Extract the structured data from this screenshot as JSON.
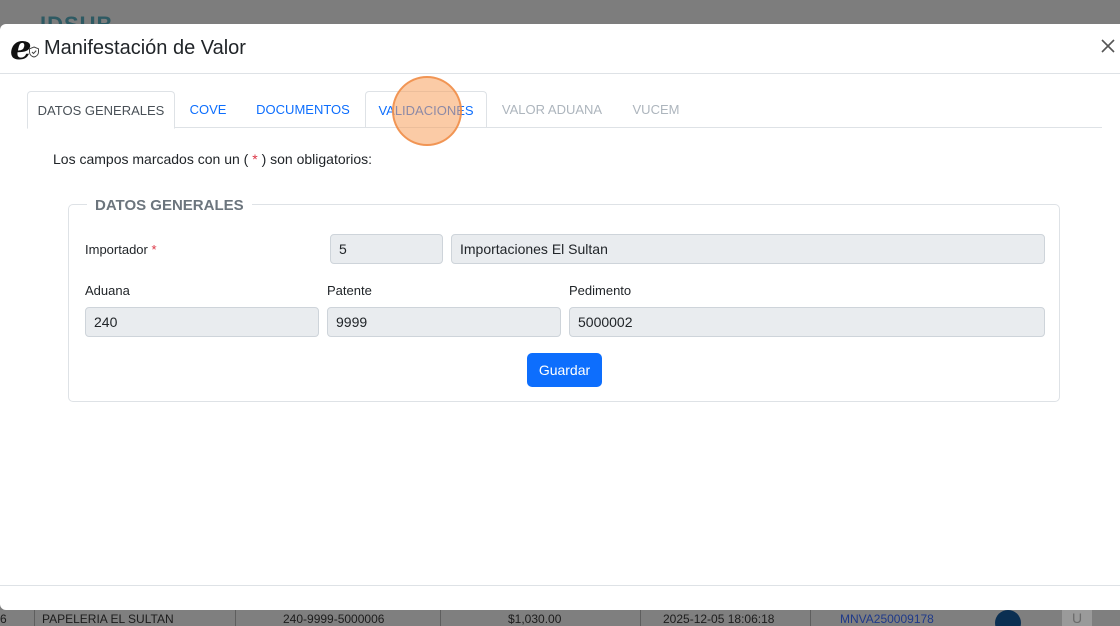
{
  "background": {
    "app_logo": "IDSUB",
    "row": {
      "index": "6",
      "company": "PAPELERIA EL SULTAN",
      "pedimento": "240-9999-5000006",
      "amount": "$1,030.00",
      "datetime": "2025-12-05 18:06:18",
      "folio": "MNVA25000917​8",
      "u_label": "U"
    }
  },
  "modal": {
    "title": "Manifestación de Valor",
    "tabs": [
      {
        "label": "DATOS GENERALES"
      },
      {
        "label": "COVE"
      },
      {
        "label": "DOCUMENTOS"
      },
      {
        "label": "VALIDACIONES"
      },
      {
        "label": "VALOR ADUANA"
      },
      {
        "label": "VUCEM"
      }
    ],
    "required_note_prefix": "Los campos marcados con un (",
    "required_star": "*",
    "required_note_suffix": ") son obligatorios:",
    "section_title": "DATOS GENERALES",
    "importador": {
      "label": "Importador",
      "star": "*",
      "code": "5",
      "name": "Importaciones El Sultan"
    },
    "aduana": {
      "label": "Aduana",
      "value": "240"
    },
    "patente": {
      "label": "Patente",
      "value": "9999"
    },
    "pedimento": {
      "label": "Pedimento",
      "value": "5000002"
    },
    "save_label": "Guardar"
  },
  "colors": {
    "primary": "#0d6efd",
    "required": "#dc3545",
    "readonly_bg": "#e9ecef",
    "click_marker": "#f7a05c"
  },
  "icons": {
    "close": "close-icon",
    "brand": "brand-e-shield-icon"
  }
}
